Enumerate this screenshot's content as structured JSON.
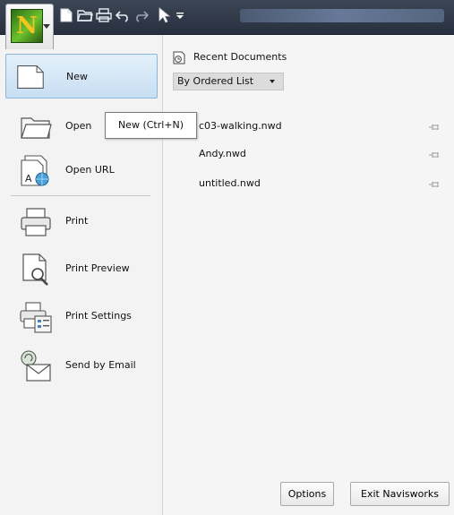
{
  "app": {
    "logo_letter": "N",
    "logo_icon": "navisworks-logo-icon"
  },
  "quick_access": {
    "items": [
      "new-document-icon",
      "open-folder-icon",
      "print-icon",
      "undo-icon",
      "redo-icon",
      "select-arrow-icon",
      "customize-dropdown-icon"
    ]
  },
  "menu": {
    "items": [
      {
        "label": "New",
        "icon": "new-document-icon",
        "selected": true
      },
      {
        "label": "Open",
        "icon": "open-folder-icon"
      },
      {
        "label": "Open URL",
        "icon": "open-url-icon"
      },
      {
        "label": "Print",
        "icon": "printer-icon"
      },
      {
        "label": "Print Preview",
        "icon": "print-preview-icon"
      },
      {
        "label": "Print Settings",
        "icon": "print-settings-icon"
      },
      {
        "label": "Send by Email",
        "icon": "email-icon"
      }
    ]
  },
  "tooltip": {
    "text": "New (Ctrl+N)"
  },
  "recent": {
    "header": "Recent Documents",
    "order_selected": "By Ordered List",
    "documents": [
      {
        "name": "c03-walking.nwd"
      },
      {
        "name": "Andy.nwd"
      },
      {
        "name": "untitled.nwd"
      }
    ]
  },
  "footer": {
    "options_label": "Options",
    "exit_label": "Exit Navisworks"
  },
  "colors": {
    "titlebar": "#283040",
    "menu_selected": "#c8def2",
    "logo_green": "#6ac22c",
    "logo_letter": "#f2c420"
  }
}
